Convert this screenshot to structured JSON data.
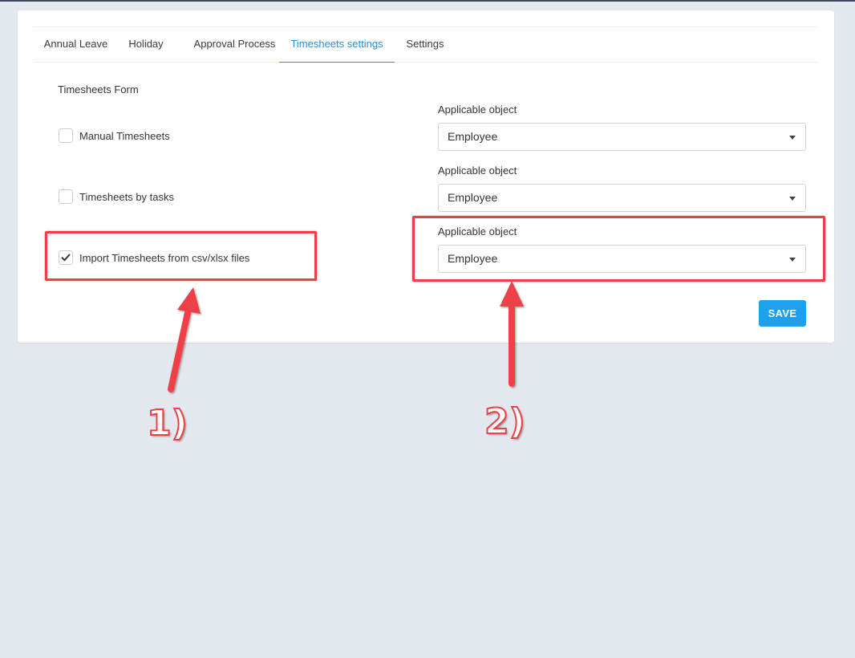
{
  "tabs": [
    {
      "label": "Annual Leave",
      "active": false
    },
    {
      "label": "Holiday",
      "active": false
    },
    {
      "label": "Approval Process",
      "active": false
    },
    {
      "label": "Timesheets settings",
      "active": true
    },
    {
      "label": "Settings",
      "active": false
    }
  ],
  "form": {
    "title": "Timesheets Form",
    "options": [
      {
        "label": "Manual Timesheets",
        "checked": false
      },
      {
        "label": "Timesheets by tasks",
        "checked": false
      },
      {
        "label": "Import Timesheets from csv/xlsx files",
        "checked": true
      }
    ],
    "selects": [
      {
        "label": "Applicable object",
        "value": "Employee"
      },
      {
        "label": "Applicable object",
        "value": "Employee"
      },
      {
        "label": "Applicable object",
        "value": "Employee"
      }
    ],
    "save_label": "SAVE"
  },
  "annotations": {
    "step1": "1)",
    "step2": "2)",
    "color": "#ee3f47"
  },
  "colors": {
    "accent": "#2c8dd6",
    "button": "#1da1ee",
    "background": "#e3e7ee"
  }
}
